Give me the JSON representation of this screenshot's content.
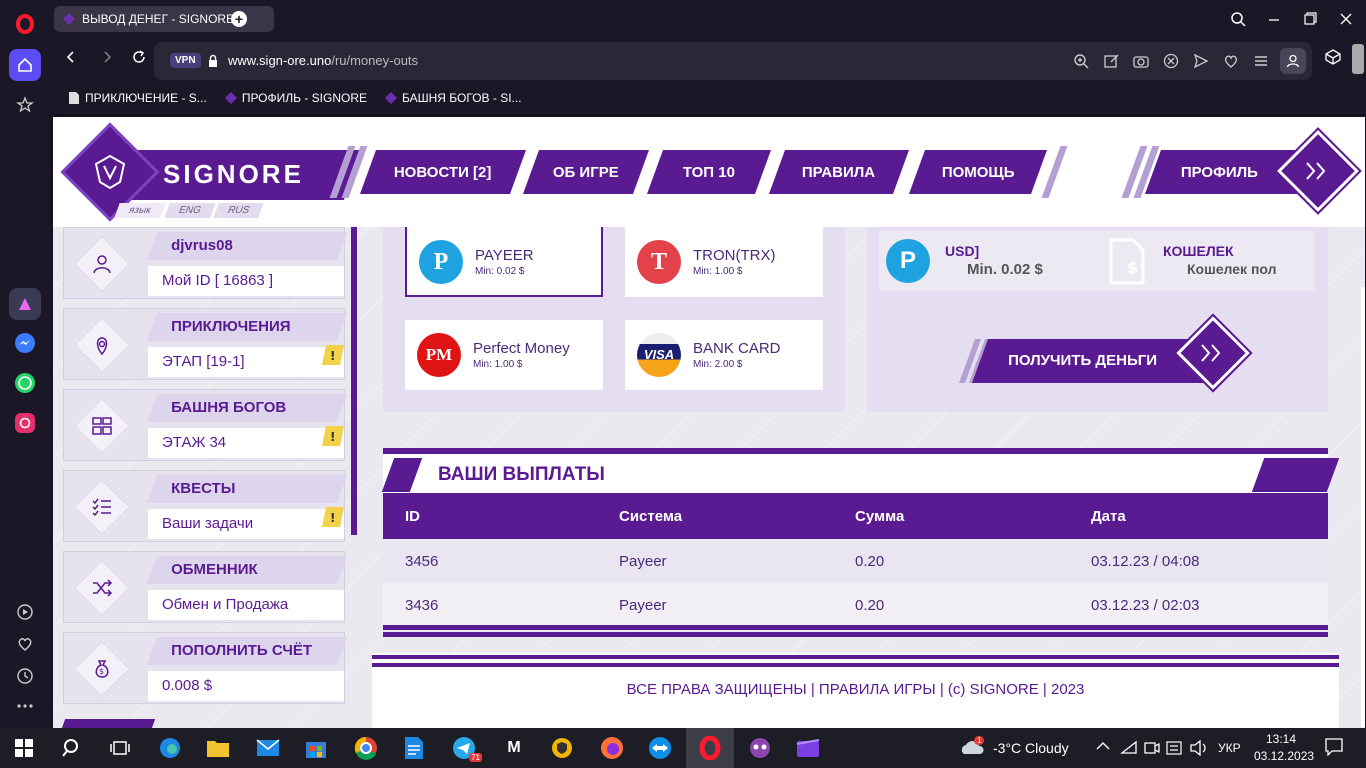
{
  "browser": {
    "tab_title": "ВЫВОД ДЕНЕГ - SIGNORE",
    "url_domain": "www.sign-ore.uno",
    "url_path": "/ru/money-outs",
    "vpn_label": "VPN",
    "bookmarks": [
      "ПРИКЛЮЧЕНИЕ - S...",
      "ПРОФИЛЬ - SIGNORE",
      "БАШНЯ БОГОВ - SI..."
    ]
  },
  "site": {
    "logo_text": "SIGNORE",
    "nav": [
      "НОВОСТИ [2]",
      "ОБ ИГРЕ",
      "ТОП 10",
      "ПРАВИЛА",
      "ПОМОЩЬ"
    ],
    "profile_label": "ПРОФИЛЬ",
    "lang_label": "язык",
    "langs": [
      "ENG",
      "RUS"
    ]
  },
  "left_cards": [
    {
      "title": "djvrus08",
      "sub": "Мой ID [ 16863 ]",
      "icon": "user-icon",
      "warn": false
    },
    {
      "title": "ПРИКЛЮЧЕНИЯ",
      "sub": "ЭТАП [19-1]",
      "icon": "map-pin-icon",
      "warn": true
    },
    {
      "title": "БАШНЯ БОГОВ",
      "sub": "ЭТАЖ 34",
      "icon": "tower-icon",
      "warn": true
    },
    {
      "title": "КВЕСТЫ",
      "sub": "Ваши задачи",
      "icon": "checklist-icon",
      "warn": true
    },
    {
      "title": "ОБМЕННИК",
      "sub": "Обмен и Продажа",
      "icon": "shuffle-icon",
      "warn": false
    },
    {
      "title": "ПОПОЛНИТЬ СЧЁТ",
      "sub": "0.008 $",
      "icon": "money-bag-icon",
      "warn": false
    }
  ],
  "warn_mark": "!",
  "payment_methods": [
    {
      "name": "PAYEER",
      "min": "Min: 0.02 $",
      "color": "#1fa3e0",
      "logo": "P"
    },
    {
      "name": "TRON(TRX)",
      "min": "Min: 1.00 $",
      "color": "#e4424b",
      "logo": "T"
    },
    {
      "name": "Perfect Money",
      "min": "Min: 1.00 $",
      "color": "#e01414",
      "logo": "PM"
    },
    {
      "name": "BANK CARD",
      "min": "Min: 2.00 $",
      "color": "#1a1f71",
      "logo": "VISA"
    }
  ],
  "selected_method": {
    "currency": "USD]",
    "min": "Min. 0.02 $",
    "wallet_label": "КОШЕЛЕК",
    "wallet_placeholder": "Кошелек пол"
  },
  "get_money_label": "ПОЛУЧИТЬ ДЕНЬГИ",
  "payouts": {
    "title": "ВАШИ ВЫПЛАТЫ",
    "columns": [
      "ID",
      "Система",
      "Сумма",
      "Дата"
    ],
    "rows": [
      [
        "3456",
        "Payeer",
        "0.20",
        "03.12.23 / 04:08"
      ],
      [
        "3436",
        "Payeer",
        "0.20",
        "03.12.23 / 02:03"
      ]
    ]
  },
  "footer": "ВСЕ ПРАВА ЗАЩИЩЕНЫ | ПРАВИЛА ИГРЫ | (c) SIGNORE | 2023",
  "taskbar": {
    "weather": "-3°C  Cloudy",
    "lang": "УКР",
    "time": "13:14",
    "date": "03.12.2023",
    "telegram_badge": "71",
    "weather_badge": "1",
    "m_label": "M"
  },
  "colors": {
    "accent": "#5a1a91",
    "light": "#e4def0"
  }
}
